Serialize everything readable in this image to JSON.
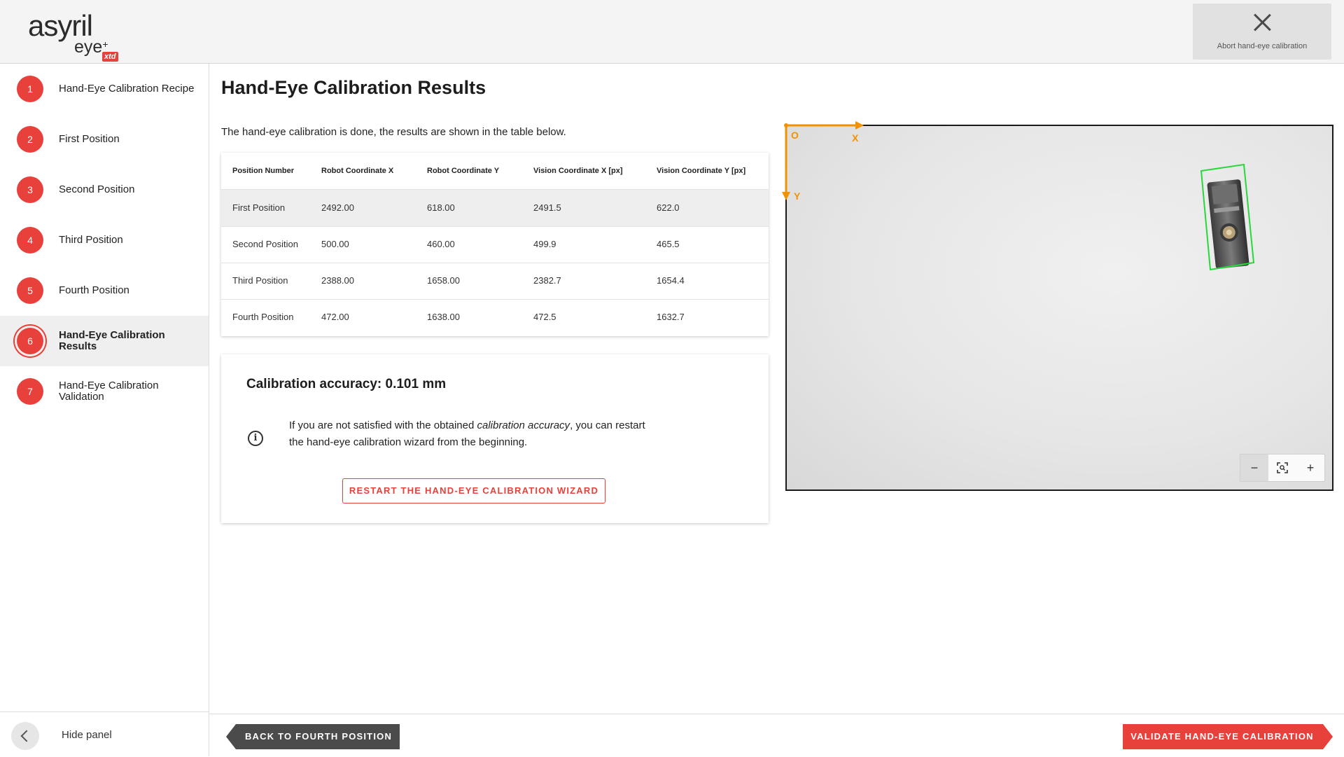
{
  "logo": {
    "brand": "asyril",
    "sub": "eye",
    "sup": "+",
    "tag": "xtd"
  },
  "header": {
    "abort_label": "Abort hand-eye calibration"
  },
  "sidebar": {
    "steps": [
      {
        "number": "1",
        "label": "Hand-Eye Calibration Recipe"
      },
      {
        "number": "2",
        "label": "First Position"
      },
      {
        "number": "3",
        "label": "Second Position"
      },
      {
        "number": "4",
        "label": "Third Position"
      },
      {
        "number": "5",
        "label": "Fourth Position"
      },
      {
        "number": "6",
        "label": "Hand-Eye Calibration Results",
        "active": true
      },
      {
        "number": "7",
        "label": "Hand-Eye Calibration Validation"
      }
    ],
    "hide_label": "Hide panel"
  },
  "main": {
    "title": "Hand-Eye Calibration Results",
    "intro": "The hand-eye calibration is done, the results are shown in the table below.",
    "table": {
      "columns": [
        "Position Number",
        "Robot Coordinate X",
        "Robot Coordinate Y",
        "Vision Coordinate X [px]",
        "Vision Coordinate Y [px]"
      ],
      "rows": [
        [
          "First Position",
          "2492.00",
          "618.00",
          "2491.5",
          "622.0"
        ],
        [
          "Second Position",
          "500.00",
          "460.00",
          "499.9",
          "465.5"
        ],
        [
          "Third Position",
          "2388.00",
          "1658.00",
          "2382.7",
          "1654.4"
        ],
        [
          "Fourth Position",
          "472.00",
          "1638.00",
          "472.5",
          "1632.7"
        ]
      ]
    },
    "accuracy": {
      "title": "Calibration accuracy: 0.101 mm",
      "info_before": "If you are not satisfied with the obtained ",
      "info_em": "calibration accuracy",
      "info_after": ", you can restart the hand-eye calibration wizard from the beginning.",
      "restart_label": "RESTART THE HAND-EYE CALIBRATION WIZARD"
    }
  },
  "camera": {
    "origin_label": "O",
    "x_label": "X",
    "y_label": "Y",
    "axis_color": "#f39200",
    "detection_color": "#27d83a",
    "zoom": {
      "minus": "−",
      "plus": "+"
    }
  },
  "footer": {
    "back_label": "BACK TO FOURTH POSITION",
    "validate_label": "VALIDATE HAND-EYE CALIBRATION"
  },
  "colors": {
    "accent": "#e8403a",
    "dark_button": "#4b4b4b"
  }
}
